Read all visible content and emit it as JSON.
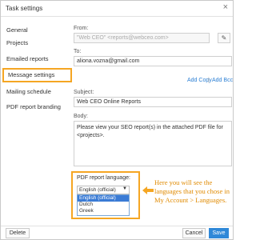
{
  "dialog": {
    "title": "Task settings"
  },
  "sidebar": {
    "items": [
      {
        "label": "General"
      },
      {
        "label": "Projects"
      },
      {
        "label": "Emailed reports"
      },
      {
        "label": "Message settings"
      },
      {
        "label": "Mailing schedule"
      },
      {
        "label": "PDF report branding"
      }
    ]
  },
  "message": {
    "from_label": "From:",
    "from_value": "\"Web CEO\" <reports@webceo.com>",
    "to_label": "To:",
    "to_value": "aliona.vozna@gmail.com",
    "add_copy": "Add Copy",
    "separator": "|",
    "add_bcc": "Add Bcc",
    "subject_label": "Subject:",
    "subject_value": "Web CEO Online Reports",
    "body_label": "Body:",
    "body_value": "Please view your SEO report(s) in the attached PDF file for <projects>."
  },
  "pdf_language": {
    "label": "PDF report language:",
    "selected": "English (official)",
    "options": [
      "English (official)",
      "Dutch",
      "Greek"
    ]
  },
  "annotation": {
    "text": "Here  you will see the languages that you chose in My Account > Languages."
  },
  "footer": {
    "delete_label": "Delete",
    "cancel_label": "Cancel",
    "save_label": "Save"
  },
  "colors": {
    "highlight": "#f5a623",
    "link": "#2b7fd4",
    "primary": "#2f88d8"
  }
}
